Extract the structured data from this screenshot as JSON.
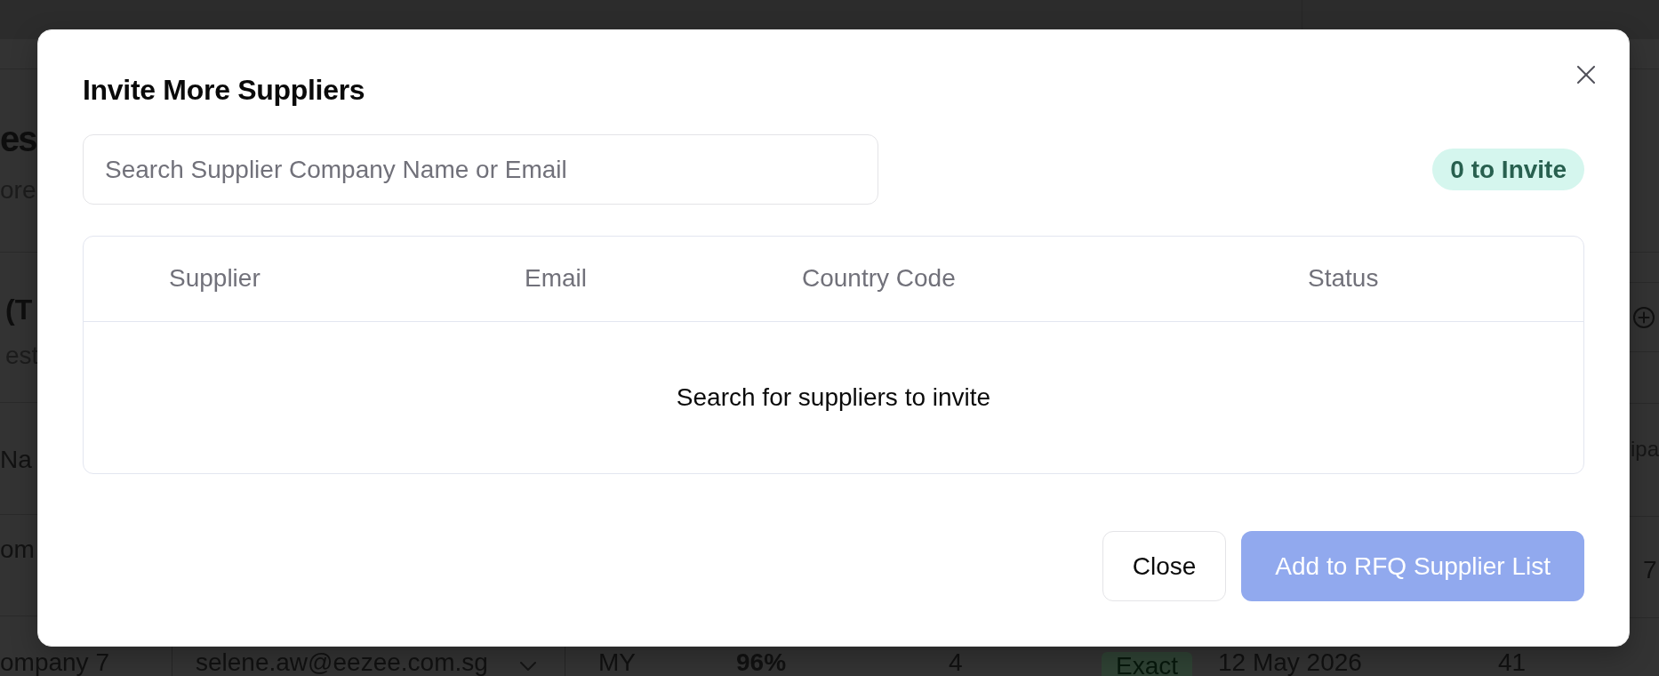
{
  "background_page": {
    "left_fragments": [
      {
        "kind": "title",
        "text": "es"
      },
      {
        "kind": "subtitle",
        "text": "ore"
      },
      {
        "kind": "section_title",
        "text": "(T"
      },
      {
        "kind": "subtitle",
        "text": "est"
      },
      {
        "kind": "text",
        "text": "Na"
      },
      {
        "kind": "text",
        "text": "om"
      }
    ],
    "right_fragments": [
      "ipa",
      "7"
    ],
    "bottom_row": [
      {
        "kind": "text",
        "text": "ompany 7"
      },
      {
        "kind": "select",
        "text": "selene.aw@eezee.com.sg"
      },
      {
        "kind": "text",
        "text": "MY"
      },
      {
        "kind": "strong_text",
        "text": "96%"
      },
      {
        "kind": "text",
        "text": "4"
      },
      {
        "kind": "tag",
        "text": "Exact"
      },
      {
        "kind": "text",
        "text": "12 May 2026"
      },
      {
        "kind": "text",
        "text": "41"
      }
    ]
  },
  "dialog": {
    "title": "Invite More Suppliers",
    "search": {
      "placeholder": "Search Supplier Company Name or Email"
    },
    "invite_count": "0 to Invite",
    "table": {
      "columns": [
        "Supplier",
        "Email",
        "Country Code",
        "Status"
      ],
      "empty_message": "Search for suppliers to invite"
    },
    "buttons": [
      {
        "label": "Close",
        "kind": "secondary",
        "disabled": false
      },
      {
        "label": "Add to RFQ Supplier List",
        "kind": "primary",
        "disabled": true
      }
    ]
  }
}
